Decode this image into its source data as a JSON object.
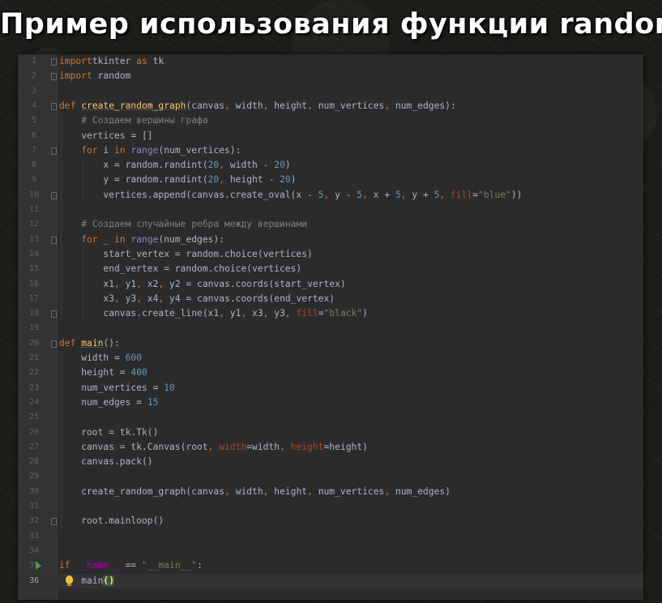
{
  "header": {
    "title": "Пример использования функции random"
  },
  "editor": {
    "current_line": 36,
    "lines": [
      {
        "n": "1",
        "indent": 0,
        "fold": true,
        "tokens": [
          [
            "kw",
            "import"
          ],
          [
            "",
            "tkinter "
          ],
          [
            "kw",
            "as"
          ],
          [
            "",
            " tk"
          ]
        ]
      },
      {
        "n": "2",
        "indent": 0,
        "fold": true,
        "tokens": [
          [
            "kw",
            "import"
          ],
          [
            "",
            " random"
          ]
        ]
      },
      {
        "n": "3",
        "indent": 0,
        "tokens": []
      },
      {
        "n": "4",
        "indent": 0,
        "fold": true,
        "tokens": [
          [
            "kw",
            "def "
          ],
          [
            "fn",
            "create_random_graph"
          ],
          [
            "",
            "(canvas"
          ],
          [
            "kw",
            ","
          ],
          [
            "",
            " width"
          ],
          [
            "kw",
            ","
          ],
          [
            "",
            " height"
          ],
          [
            "kw",
            ","
          ],
          [
            "",
            " num_vertices"
          ],
          [
            "kw",
            ","
          ],
          [
            "",
            " num_edges):"
          ]
        ]
      },
      {
        "n": "5",
        "indent": 4,
        "tokens": [
          [
            "cm",
            "# Создаем вершины графа"
          ]
        ]
      },
      {
        "n": "6",
        "indent": 4,
        "tokens": [
          [
            "",
            "vertices = []"
          ]
        ]
      },
      {
        "n": "7",
        "indent": 4,
        "fold": true,
        "tokens": [
          [
            "kw",
            "for "
          ],
          [
            "",
            "i "
          ],
          [
            "kw",
            "in "
          ],
          [
            "bi",
            "range"
          ],
          [
            "",
            "(num_vertices):"
          ]
        ]
      },
      {
        "n": "8",
        "indent": 8,
        "tokens": [
          [
            "",
            "x = random.randint("
          ],
          [
            "num",
            "20"
          ],
          [
            "kw",
            ","
          ],
          [
            "",
            " width - "
          ],
          [
            "num",
            "20"
          ],
          [
            "",
            ")"
          ]
        ]
      },
      {
        "n": "9",
        "indent": 8,
        "tokens": [
          [
            "",
            "y = random.randint("
          ],
          [
            "num",
            "20"
          ],
          [
            "kw",
            ","
          ],
          [
            "",
            " height - "
          ],
          [
            "num",
            "20"
          ],
          [
            "",
            ")"
          ]
        ]
      },
      {
        "n": "10",
        "indent": 8,
        "fold": true,
        "tokens": [
          [
            "",
            "vertices.append(canvas.create_oval(x - "
          ],
          [
            "num",
            "5"
          ],
          [
            "kw",
            ","
          ],
          [
            "",
            " y - "
          ],
          [
            "num",
            "5"
          ],
          [
            "kw",
            ","
          ],
          [
            "",
            " x + "
          ],
          [
            "num",
            "5"
          ],
          [
            "kw",
            ","
          ],
          [
            "",
            " y + "
          ],
          [
            "num",
            "5"
          ],
          [
            "kw",
            ","
          ],
          [
            "pr",
            " fill"
          ],
          [
            "",
            "="
          ],
          [
            "str",
            "\"blue\""
          ],
          [
            "",
            "))"
          ]
        ]
      },
      {
        "n": "11",
        "indent": 0,
        "tokens": []
      },
      {
        "n": "12",
        "indent": 4,
        "tokens": [
          [
            "cm",
            "# Создаем случайные ребра между вершинами"
          ]
        ]
      },
      {
        "n": "13",
        "indent": 4,
        "fold": true,
        "tokens": [
          [
            "kw",
            "for "
          ],
          [
            "",
            "_ "
          ],
          [
            "kw",
            "in "
          ],
          [
            "bi",
            "range"
          ],
          [
            "",
            "(num_edges):"
          ]
        ]
      },
      {
        "n": "14",
        "indent": 8,
        "tokens": [
          [
            "",
            "start_vertex = random.choice(vertices)"
          ]
        ]
      },
      {
        "n": "15",
        "indent": 8,
        "tokens": [
          [
            "",
            "end_vertex = random.choice(vertices)"
          ]
        ]
      },
      {
        "n": "16",
        "indent": 8,
        "tokens": [
          [
            "",
            "x1"
          ],
          [
            "kw",
            ","
          ],
          [
            "",
            " y1"
          ],
          [
            "kw",
            ","
          ],
          [
            "",
            " x2"
          ],
          [
            "kw",
            ","
          ],
          [
            "",
            " y2 = canvas.coords(start_vertex)"
          ]
        ]
      },
      {
        "n": "17",
        "indent": 8,
        "tokens": [
          [
            "",
            "x3"
          ],
          [
            "kw",
            ","
          ],
          [
            "",
            " y3"
          ],
          [
            "kw",
            ","
          ],
          [
            "",
            " x4"
          ],
          [
            "kw",
            ","
          ],
          [
            "",
            " y4 = canvas.coords(end_vertex)"
          ]
        ]
      },
      {
        "n": "18",
        "indent": 8,
        "fold": true,
        "tokens": [
          [
            "",
            "canvas.create_line(x1"
          ],
          [
            "kw",
            ","
          ],
          [
            "",
            " y1"
          ],
          [
            "kw",
            ","
          ],
          [
            "",
            " x3"
          ],
          [
            "kw",
            ","
          ],
          [
            "",
            " y3"
          ],
          [
            "kw",
            ","
          ],
          [
            "pr",
            " fill"
          ],
          [
            "",
            "="
          ],
          [
            "str",
            "\"black\""
          ],
          [
            "",
            ")"
          ]
        ]
      },
      {
        "n": "19",
        "indent": 0,
        "tokens": []
      },
      {
        "n": "20",
        "indent": 0,
        "fold": true,
        "tokens": [
          [
            "kw",
            "def "
          ],
          [
            "fn",
            "main"
          ],
          [
            "",
            "():"
          ]
        ]
      },
      {
        "n": "21",
        "indent": 4,
        "tokens": [
          [
            "",
            "width = "
          ],
          [
            "num",
            "600"
          ]
        ]
      },
      {
        "n": "22",
        "indent": 4,
        "tokens": [
          [
            "",
            "height = "
          ],
          [
            "num",
            "400"
          ]
        ]
      },
      {
        "n": "23",
        "indent": 4,
        "tokens": [
          [
            "",
            "num_vertices = "
          ],
          [
            "num",
            "10"
          ]
        ]
      },
      {
        "n": "24",
        "indent": 4,
        "tokens": [
          [
            "",
            "num_edges = "
          ],
          [
            "num",
            "15"
          ]
        ]
      },
      {
        "n": "25",
        "indent": 0,
        "tokens": []
      },
      {
        "n": "26",
        "indent": 4,
        "tokens": [
          [
            "",
            "root = tk.Tk()"
          ]
        ]
      },
      {
        "n": "27",
        "indent": 4,
        "tokens": [
          [
            "",
            "canvas = tk.Canvas(root"
          ],
          [
            "kw",
            ","
          ],
          [
            "pr",
            " width"
          ],
          [
            "",
            "=width"
          ],
          [
            "kw",
            ","
          ],
          [
            "pr",
            " height"
          ],
          [
            "",
            "=height)"
          ]
        ]
      },
      {
        "n": "28",
        "indent": 4,
        "tokens": [
          [
            "",
            "canvas.pack()"
          ]
        ]
      },
      {
        "n": "29",
        "indent": 0,
        "tokens": []
      },
      {
        "n": "30",
        "indent": 4,
        "tokens": [
          [
            "",
            "create_random_graph(canvas"
          ],
          [
            "kw",
            ","
          ],
          [
            "",
            " width"
          ],
          [
            "kw",
            ","
          ],
          [
            "",
            " height"
          ],
          [
            "kw",
            ","
          ],
          [
            "",
            " num_vertices"
          ],
          [
            "kw",
            ","
          ],
          [
            "",
            " num_edges)"
          ]
        ]
      },
      {
        "n": "31",
        "indent": 0,
        "tokens": []
      },
      {
        "n": "32",
        "indent": 4,
        "fold": true,
        "tokens": [
          [
            "",
            "root.mainloop()"
          ]
        ]
      },
      {
        "n": "33",
        "indent": 0,
        "tokens": []
      },
      {
        "n": "34",
        "indent": 0,
        "tokens": []
      },
      {
        "n": "35",
        "indent": 0,
        "run": true,
        "tokens": [
          [
            "kw",
            "if "
          ],
          [
            "mg",
            "__name__"
          ],
          [
            "",
            " == "
          ],
          [
            "str",
            "\"__main__\""
          ],
          [
            "",
            ":"
          ]
        ]
      },
      {
        "n": "36",
        "indent": 4,
        "bulb": true,
        "tokens": [
          [
            "",
            "main"
          ],
          [
            "br",
            "()"
          ]
        ]
      }
    ]
  },
  "colors": {
    "editor_bg": "#2b2b2b",
    "gutter_bg": "#313335",
    "keyword": "#cc7832",
    "function": "#ffc66d",
    "number": "#6897bb",
    "string": "#6a8759",
    "comment": "#808080"
  },
  "icons": {
    "run": "run-triangle-icon",
    "intention": "lightbulb-icon",
    "fold": "fold-marker-icon"
  }
}
